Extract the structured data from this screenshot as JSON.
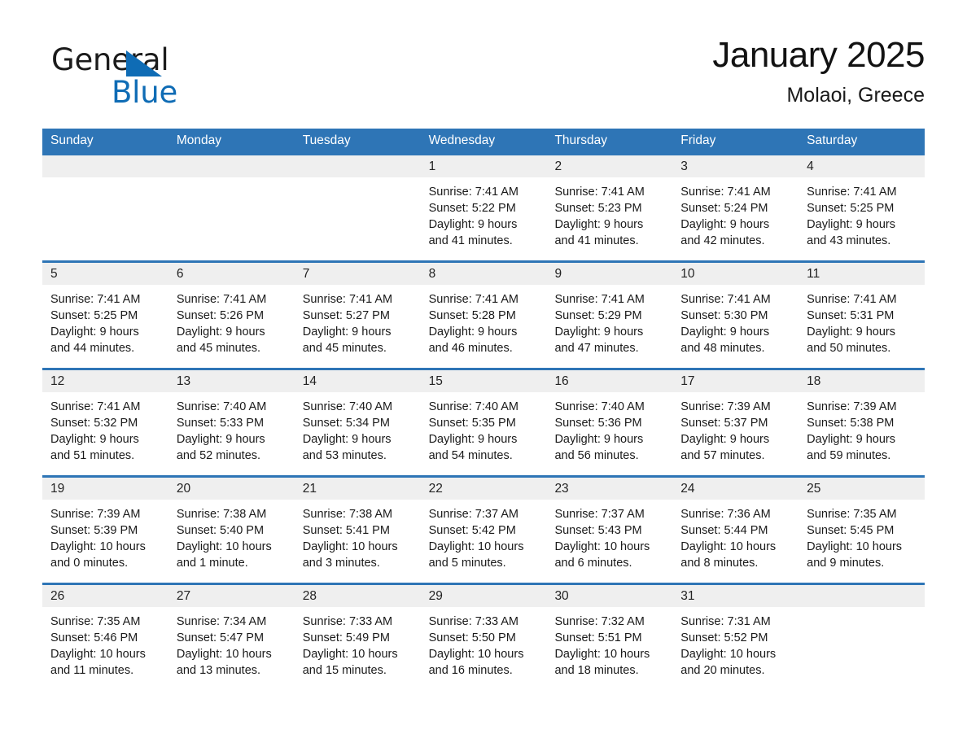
{
  "brand": {
    "name_part1": "General",
    "name_part2": "Blue",
    "accent_color": "#0f6cb5"
  },
  "header": {
    "month_title": "January 2025",
    "location": "Molaoi, Greece"
  },
  "theme": {
    "header_blue": "#2e75b6",
    "datebar_gray": "#efefef"
  },
  "weekdays": [
    "Sunday",
    "Monday",
    "Tuesday",
    "Wednesday",
    "Thursday",
    "Friday",
    "Saturday"
  ],
  "weeks": [
    [
      {
        "day": "",
        "sunrise": "",
        "sunset": "",
        "daylight_line1": "",
        "daylight_line2": ""
      },
      {
        "day": "",
        "sunrise": "",
        "sunset": "",
        "daylight_line1": "",
        "daylight_line2": ""
      },
      {
        "day": "",
        "sunrise": "",
        "sunset": "",
        "daylight_line1": "",
        "daylight_line2": ""
      },
      {
        "day": "1",
        "sunrise": "Sunrise: 7:41 AM",
        "sunset": "Sunset: 5:22 PM",
        "daylight_line1": "Daylight: 9 hours",
        "daylight_line2": "and 41 minutes."
      },
      {
        "day": "2",
        "sunrise": "Sunrise: 7:41 AM",
        "sunset": "Sunset: 5:23 PM",
        "daylight_line1": "Daylight: 9 hours",
        "daylight_line2": "and 41 minutes."
      },
      {
        "day": "3",
        "sunrise": "Sunrise: 7:41 AM",
        "sunset": "Sunset: 5:24 PM",
        "daylight_line1": "Daylight: 9 hours",
        "daylight_line2": "and 42 minutes."
      },
      {
        "day": "4",
        "sunrise": "Sunrise: 7:41 AM",
        "sunset": "Sunset: 5:25 PM",
        "daylight_line1": "Daylight: 9 hours",
        "daylight_line2": "and 43 minutes."
      }
    ],
    [
      {
        "day": "5",
        "sunrise": "Sunrise: 7:41 AM",
        "sunset": "Sunset: 5:25 PM",
        "daylight_line1": "Daylight: 9 hours",
        "daylight_line2": "and 44 minutes."
      },
      {
        "day": "6",
        "sunrise": "Sunrise: 7:41 AM",
        "sunset": "Sunset: 5:26 PM",
        "daylight_line1": "Daylight: 9 hours",
        "daylight_line2": "and 45 minutes."
      },
      {
        "day": "7",
        "sunrise": "Sunrise: 7:41 AM",
        "sunset": "Sunset: 5:27 PM",
        "daylight_line1": "Daylight: 9 hours",
        "daylight_line2": "and 45 minutes."
      },
      {
        "day": "8",
        "sunrise": "Sunrise: 7:41 AM",
        "sunset": "Sunset: 5:28 PM",
        "daylight_line1": "Daylight: 9 hours",
        "daylight_line2": "and 46 minutes."
      },
      {
        "day": "9",
        "sunrise": "Sunrise: 7:41 AM",
        "sunset": "Sunset: 5:29 PM",
        "daylight_line1": "Daylight: 9 hours",
        "daylight_line2": "and 47 minutes."
      },
      {
        "day": "10",
        "sunrise": "Sunrise: 7:41 AM",
        "sunset": "Sunset: 5:30 PM",
        "daylight_line1": "Daylight: 9 hours",
        "daylight_line2": "and 48 minutes."
      },
      {
        "day": "11",
        "sunrise": "Sunrise: 7:41 AM",
        "sunset": "Sunset: 5:31 PM",
        "daylight_line1": "Daylight: 9 hours",
        "daylight_line2": "and 50 minutes."
      }
    ],
    [
      {
        "day": "12",
        "sunrise": "Sunrise: 7:41 AM",
        "sunset": "Sunset: 5:32 PM",
        "daylight_line1": "Daylight: 9 hours",
        "daylight_line2": "and 51 minutes."
      },
      {
        "day": "13",
        "sunrise": "Sunrise: 7:40 AM",
        "sunset": "Sunset: 5:33 PM",
        "daylight_line1": "Daylight: 9 hours",
        "daylight_line2": "and 52 minutes."
      },
      {
        "day": "14",
        "sunrise": "Sunrise: 7:40 AM",
        "sunset": "Sunset: 5:34 PM",
        "daylight_line1": "Daylight: 9 hours",
        "daylight_line2": "and 53 minutes."
      },
      {
        "day": "15",
        "sunrise": "Sunrise: 7:40 AM",
        "sunset": "Sunset: 5:35 PM",
        "daylight_line1": "Daylight: 9 hours",
        "daylight_line2": "and 54 minutes."
      },
      {
        "day": "16",
        "sunrise": "Sunrise: 7:40 AM",
        "sunset": "Sunset: 5:36 PM",
        "daylight_line1": "Daylight: 9 hours",
        "daylight_line2": "and 56 minutes."
      },
      {
        "day": "17",
        "sunrise": "Sunrise: 7:39 AM",
        "sunset": "Sunset: 5:37 PM",
        "daylight_line1": "Daylight: 9 hours",
        "daylight_line2": "and 57 minutes."
      },
      {
        "day": "18",
        "sunrise": "Sunrise: 7:39 AM",
        "sunset": "Sunset: 5:38 PM",
        "daylight_line1": "Daylight: 9 hours",
        "daylight_line2": "and 59 minutes."
      }
    ],
    [
      {
        "day": "19",
        "sunrise": "Sunrise: 7:39 AM",
        "sunset": "Sunset: 5:39 PM",
        "daylight_line1": "Daylight: 10 hours",
        "daylight_line2": "and 0 minutes."
      },
      {
        "day": "20",
        "sunrise": "Sunrise: 7:38 AM",
        "sunset": "Sunset: 5:40 PM",
        "daylight_line1": "Daylight: 10 hours",
        "daylight_line2": "and 1 minute."
      },
      {
        "day": "21",
        "sunrise": "Sunrise: 7:38 AM",
        "sunset": "Sunset: 5:41 PM",
        "daylight_line1": "Daylight: 10 hours",
        "daylight_line2": "and 3 minutes."
      },
      {
        "day": "22",
        "sunrise": "Sunrise: 7:37 AM",
        "sunset": "Sunset: 5:42 PM",
        "daylight_line1": "Daylight: 10 hours",
        "daylight_line2": "and 5 minutes."
      },
      {
        "day": "23",
        "sunrise": "Sunrise: 7:37 AM",
        "sunset": "Sunset: 5:43 PM",
        "daylight_line1": "Daylight: 10 hours",
        "daylight_line2": "and 6 minutes."
      },
      {
        "day": "24",
        "sunrise": "Sunrise: 7:36 AM",
        "sunset": "Sunset: 5:44 PM",
        "daylight_line1": "Daylight: 10 hours",
        "daylight_line2": "and 8 minutes."
      },
      {
        "day": "25",
        "sunrise": "Sunrise: 7:35 AM",
        "sunset": "Sunset: 5:45 PM",
        "daylight_line1": "Daylight: 10 hours",
        "daylight_line2": "and 9 minutes."
      }
    ],
    [
      {
        "day": "26",
        "sunrise": "Sunrise: 7:35 AM",
        "sunset": "Sunset: 5:46 PM",
        "daylight_line1": "Daylight: 10 hours",
        "daylight_line2": "and 11 minutes."
      },
      {
        "day": "27",
        "sunrise": "Sunrise: 7:34 AM",
        "sunset": "Sunset: 5:47 PM",
        "daylight_line1": "Daylight: 10 hours",
        "daylight_line2": "and 13 minutes."
      },
      {
        "day": "28",
        "sunrise": "Sunrise: 7:33 AM",
        "sunset": "Sunset: 5:49 PM",
        "daylight_line1": "Daylight: 10 hours",
        "daylight_line2": "and 15 minutes."
      },
      {
        "day": "29",
        "sunrise": "Sunrise: 7:33 AM",
        "sunset": "Sunset: 5:50 PM",
        "daylight_line1": "Daylight: 10 hours",
        "daylight_line2": "and 16 minutes."
      },
      {
        "day": "30",
        "sunrise": "Sunrise: 7:32 AM",
        "sunset": "Sunset: 5:51 PM",
        "daylight_line1": "Daylight: 10 hours",
        "daylight_line2": "and 18 minutes."
      },
      {
        "day": "31",
        "sunrise": "Sunrise: 7:31 AM",
        "sunset": "Sunset: 5:52 PM",
        "daylight_line1": "Daylight: 10 hours",
        "daylight_line2": "and 20 minutes."
      },
      {
        "day": "",
        "sunrise": "",
        "sunset": "",
        "daylight_line1": "",
        "daylight_line2": ""
      }
    ]
  ]
}
